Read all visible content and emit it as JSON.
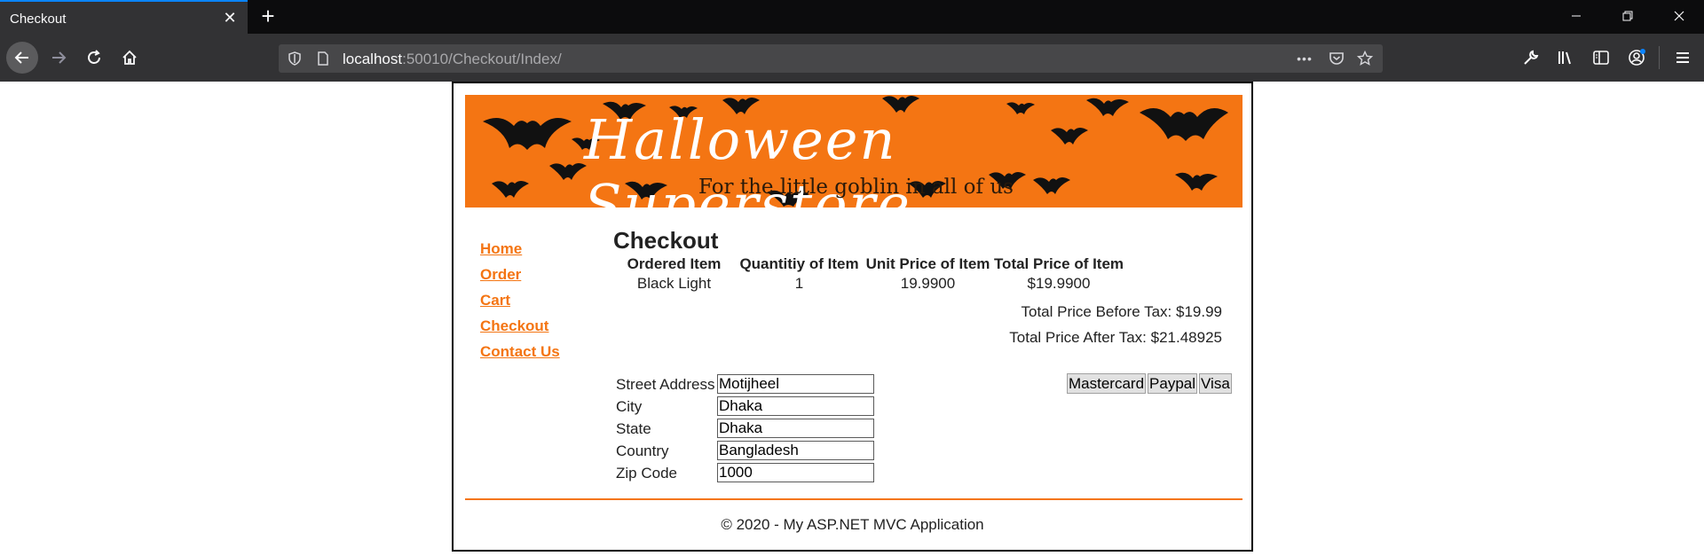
{
  "browser": {
    "tab_title": "Checkout",
    "tab_close": "✕",
    "new_tab": "+",
    "url_host": "localhost",
    "url_path": ":50010/Checkout/Index/",
    "url_more": "•••"
  },
  "banner": {
    "title": "Halloween Superstore",
    "subtitle": "For the little goblin in all of us"
  },
  "sidebar": {
    "items": [
      {
        "label": "Home"
      },
      {
        "label": "Order"
      },
      {
        "label": "Cart"
      },
      {
        "label": "Checkout"
      },
      {
        "label": "Contact Us"
      }
    ]
  },
  "main": {
    "heading": "Checkout",
    "table": {
      "headers": [
        "Ordered Item",
        "Quantitiy of Item",
        "Unit Price of Item",
        "Total Price of Item"
      ],
      "rows": [
        [
          "Black Light",
          "1",
          "19.9900",
          "$19.9900"
        ]
      ]
    },
    "total_before_tax": "Total Price Before Tax: $19.99",
    "total_after_tax": "Total Price After Tax: $21.48925",
    "address": {
      "street_label": "Street Address",
      "street_value": "Motijheel",
      "city_label": "City",
      "city_value": "Dhaka",
      "state_label": "State",
      "state_value": "Dhaka",
      "country_label": "Country",
      "country_value": "Bangladesh",
      "zip_label": "Zip Code",
      "zip_value": "1000"
    },
    "payment": {
      "mastercard": "Mastercard",
      "paypal": "Paypal",
      "visa": "Visa"
    }
  },
  "footer": {
    "text": "© 2020 - My ASP.NET MVC Application"
  },
  "colors": {
    "accent": "#f47513",
    "tab_highlight": "#0a84ff",
    "chrome_dark": "#0c0c0d",
    "chrome": "#323234"
  }
}
